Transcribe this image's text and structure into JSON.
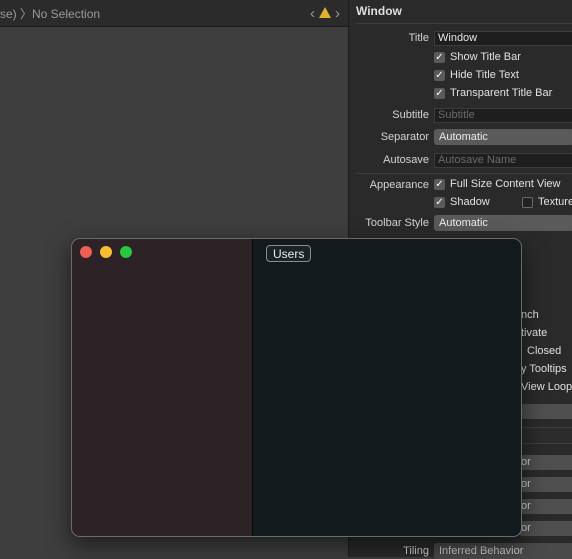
{
  "jumpbar": {
    "crumb": "se) 〉No Selection"
  },
  "inspector": {
    "title": "Window",
    "title_label": "Title",
    "title_value": "Window",
    "show_title_bar": "Show Title Bar",
    "hide_title_text": "Hide Title Text",
    "transparent_title_bar": "Transparent Title Bar",
    "subtitle_label": "Subtitle",
    "subtitle_placeholder": "Subtitle",
    "separator_label": "Separator",
    "separator_value": "Automatic",
    "autosave_label": "Autosave",
    "autosave_placeholder": "Autosave Name",
    "appearance_label": "Appearance",
    "full_size_content_view": "Full Size Content View",
    "shadow": "Shadow",
    "textured": "Texture",
    "toolbar_style_label": "Toolbar Style",
    "toolbar_style_value": "Automatic",
    "partial_1": "nch",
    "partial_2": "tivate",
    "partial_3": "Closed",
    "partial_4": "y Tooltips",
    "partial_5": "View Loop",
    "partial_or_1": "or",
    "partial_or_2": "or",
    "partial_or_3": "or",
    "partial_or_4": "or",
    "tiling_label": "Tiling",
    "tiling_value": "Inferred Behavior"
  },
  "preview": {
    "users_button": "Users"
  },
  "colors": {
    "close": "#ee5e57",
    "minimize": "#f5bf2f",
    "zoom": "#29c640",
    "warning": "#e0b12b"
  }
}
